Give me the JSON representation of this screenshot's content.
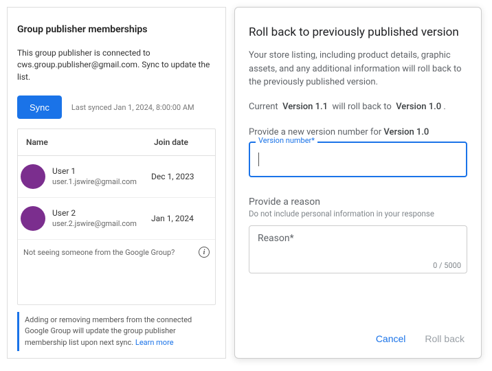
{
  "left": {
    "title": "Group publisher memberships",
    "description_pre": "This group publisher is connected to ",
    "description_email": "cws.group.publisher@gmail.com",
    "description_post": ". Sync to update the list.",
    "sync_label": "Sync",
    "last_synced": "Last synced Jan 1, 2024, 8:00:00 AM",
    "columns": {
      "name": "Name",
      "join": "Join date"
    },
    "users": [
      {
        "name": "User 1",
        "email": "user.1.jswire@gmail.com",
        "joined": "Dec 1, 2023"
      },
      {
        "name": "User 2",
        "email": "user.2.jswire@gmail.com",
        "joined": "Jan 1, 2024"
      }
    ],
    "not_seeing": "Not seeing someone from the Google Group?",
    "info_note": "Adding or removing members from the connected Google Group will update the group publisher membership list upon next sync. ",
    "learn_more": "Learn more"
  },
  "right": {
    "title": "Roll back to previously published version",
    "description": "Your store listing, including product details, graphic assets, and any additional information will roll back to the previously published version.",
    "current_label": "Current",
    "current_version": "Version 1.1",
    "mid_text": "will roll back to",
    "target_version": "Version 1.0",
    "period": ".",
    "provide_label_pre": "Provide a new version number for ",
    "provide_version": "Version 1.0",
    "float_label": "Version number*",
    "reason_title": "Provide a reason",
    "reason_sub": "Do not include personal information in your response",
    "reason_placeholder": "Reason*",
    "char_count": "0 / 5000",
    "cancel": "Cancel",
    "rollback": "Roll back"
  }
}
